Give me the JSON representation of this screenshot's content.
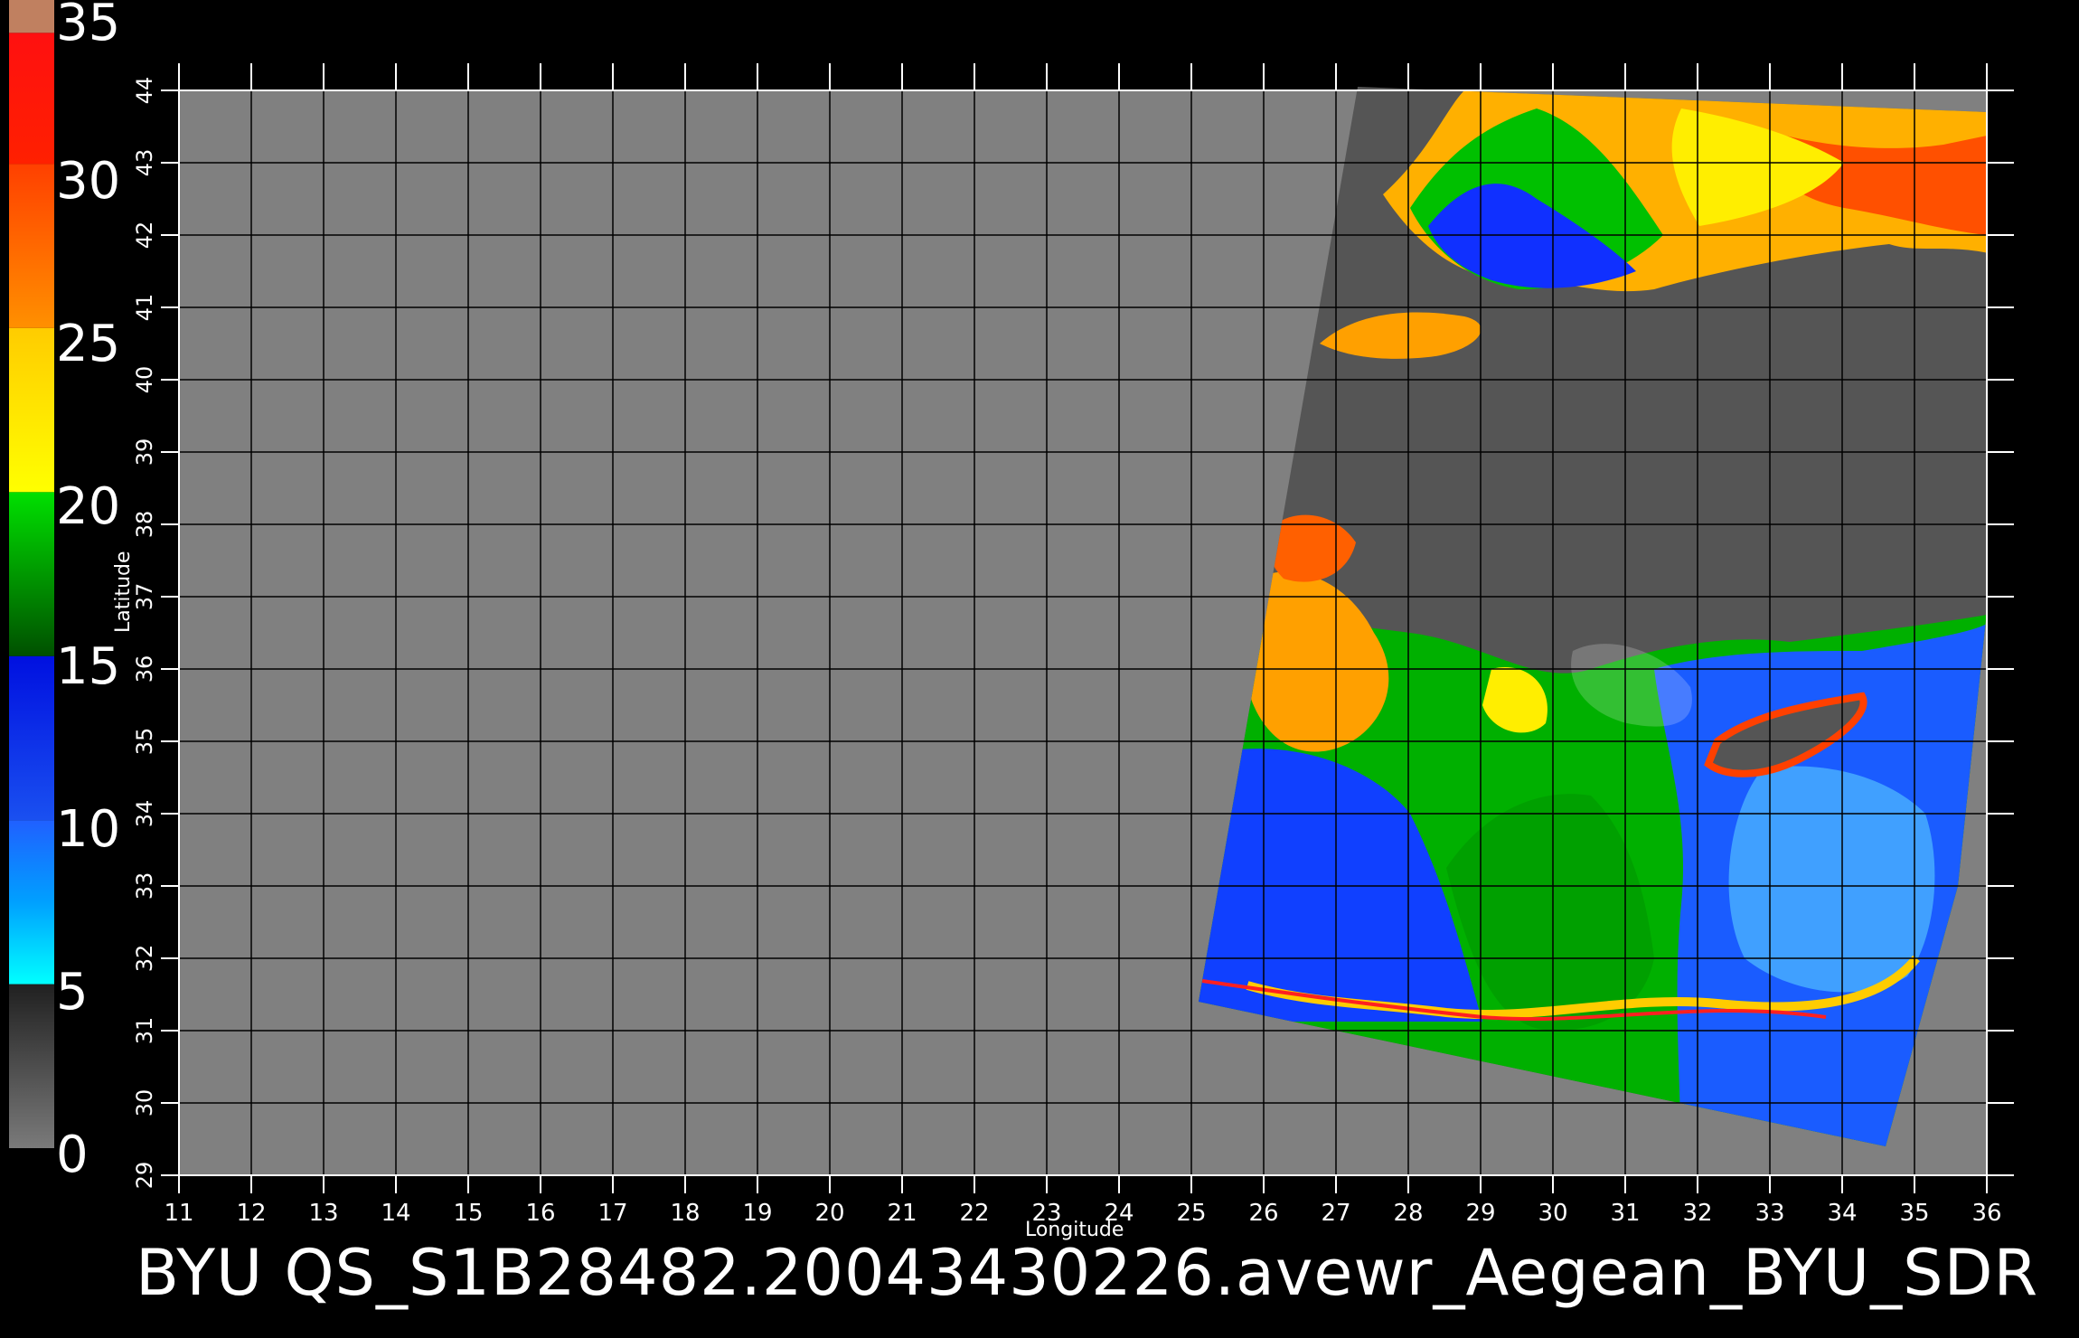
{
  "title": "BYU  QS_S1B28482.20043430226.avewr_Aegean_BYU_SDR",
  "xlabel": "Longitude",
  "ylabel": "Latitude",
  "colorbar": {
    "ticks": [
      "0",
      "5",
      "10",
      "15",
      "20",
      "25",
      "30",
      "35"
    ],
    "bands": [
      {
        "from": 0,
        "to": 5,
        "colors": [
          "#7a7a7a",
          "#202020"
        ]
      },
      {
        "from": 5,
        "to": 10,
        "colors": [
          "#00ffff",
          "#00a0ff",
          "#2060ff"
        ]
      },
      {
        "from": 10,
        "to": 15,
        "colors": [
          "#1a50f0",
          "#0010e0"
        ]
      },
      {
        "from": 15,
        "to": 20,
        "colors": [
          "#005000",
          "#00e000"
        ]
      },
      {
        "from": 20,
        "to": 25,
        "colors": [
          "#ffff00",
          "#ffcc00"
        ]
      },
      {
        "from": 25,
        "to": 30,
        "colors": [
          "#ff9000",
          "#ff4000"
        ]
      },
      {
        "from": 30,
        "to": 34,
        "colors": [
          "#ff2000",
          "#ff1010"
        ]
      },
      {
        "from": 34,
        "to": 35,
        "colors": [
          "#c08060",
          "#c08060"
        ]
      }
    ]
  },
  "map": {
    "lon_range": [
      11,
      36
    ],
    "lat_range": [
      29,
      44
    ],
    "lon_ticks": [
      "11",
      "12",
      "13",
      "14",
      "15",
      "16",
      "17",
      "18",
      "19",
      "20",
      "21",
      "22",
      "23",
      "24",
      "25",
      "26",
      "27",
      "28",
      "29",
      "30",
      "31",
      "32",
      "33",
      "34",
      "35",
      "36"
    ],
    "lat_ticks": [
      "29",
      "30",
      "31",
      "32",
      "33",
      "34",
      "35",
      "36",
      "37",
      "38",
      "39",
      "40",
      "41",
      "42",
      "43",
      "44"
    ],
    "background_color": "#808080",
    "swath_color": "#555555",
    "grid_color": "#000000",
    "swath_outline": [
      [
        27.3,
        44.05
      ],
      [
        36.0,
        43.7
      ],
      [
        36.0,
        36.8
      ],
      [
        35.6,
        33.0
      ],
      [
        34.6,
        29.4
      ],
      [
        25.1,
        31.4
      ]
    ]
  }
}
